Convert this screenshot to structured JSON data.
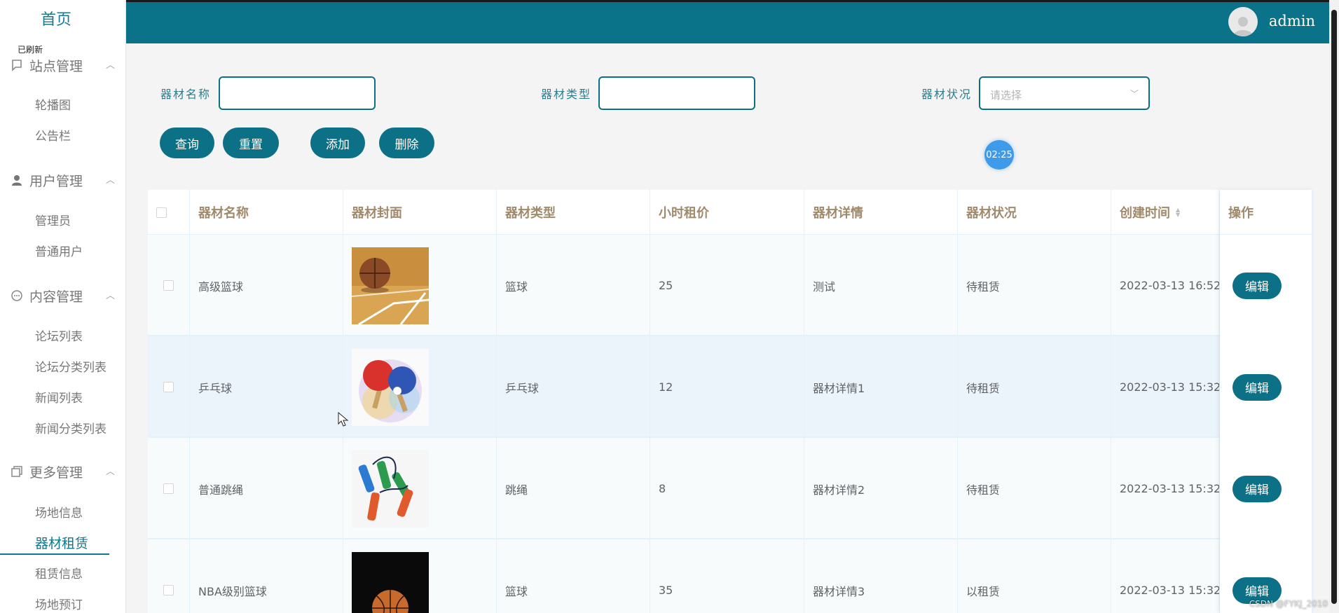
{
  "sidebar": {
    "home": "首页",
    "refresh_tag": "已刷新",
    "sections": [
      {
        "title": "站点管理",
        "icon": "flag-icon",
        "items": [
          "轮播图",
          "公告栏"
        ]
      },
      {
        "title": "用户管理",
        "icon": "user-icon",
        "items": [
          "管理员",
          "普通用户"
        ]
      },
      {
        "title": "内容管理",
        "icon": "chat-icon",
        "items": [
          "论坛列表",
          "论坛分类列表",
          "新闻列表",
          "新闻分类列表"
        ]
      },
      {
        "title": "更多管理",
        "icon": "copy-icon",
        "items": [
          "场地信息",
          "器材租赁",
          "租赁信息",
          "场地预订"
        ]
      }
    ],
    "active_item": "器材租赁"
  },
  "header": {
    "username": "admin"
  },
  "filters": {
    "name_label": "器材名称",
    "type_label": "器材类型",
    "status_label": "器材状况",
    "status_placeholder": "请选择"
  },
  "buttons": {
    "query": "查询",
    "reset": "重置",
    "add": "添加",
    "delete": "删除"
  },
  "timer": "02:25",
  "table": {
    "columns": [
      "器材名称",
      "器材封面",
      "器材类型",
      "小时租价",
      "器材详情",
      "器材状况",
      "创建时间",
      "操作"
    ],
    "rows": [
      {
        "name": "高级篮球",
        "type": "篮球",
        "price": "25",
        "detail": "测试",
        "status": "待租赁",
        "created": "2022-03-13 16:52"
      },
      {
        "name": "乒乓球",
        "type": "乒乓球",
        "price": "12",
        "detail": "器材详情1",
        "status": "待租赁",
        "created": "2022-03-13 15:32"
      },
      {
        "name": "普通跳绳",
        "type": "跳绳",
        "price": "8",
        "detail": "器材详情2",
        "status": "待租赁",
        "created": "2022-03-13 15:32"
      },
      {
        "name": "NBA级别篮球",
        "type": "篮球",
        "price": "35",
        "detail": "器材详情3",
        "status": "以租赁",
        "created": "2022-03-13 15:32"
      }
    ],
    "edit_label": "编辑"
  },
  "watermark": "CSDN @FYKJ_2010",
  "colors": {
    "primary": "#0b7389",
    "label": "#2a7d8e",
    "header_text": "#a08a6c"
  }
}
